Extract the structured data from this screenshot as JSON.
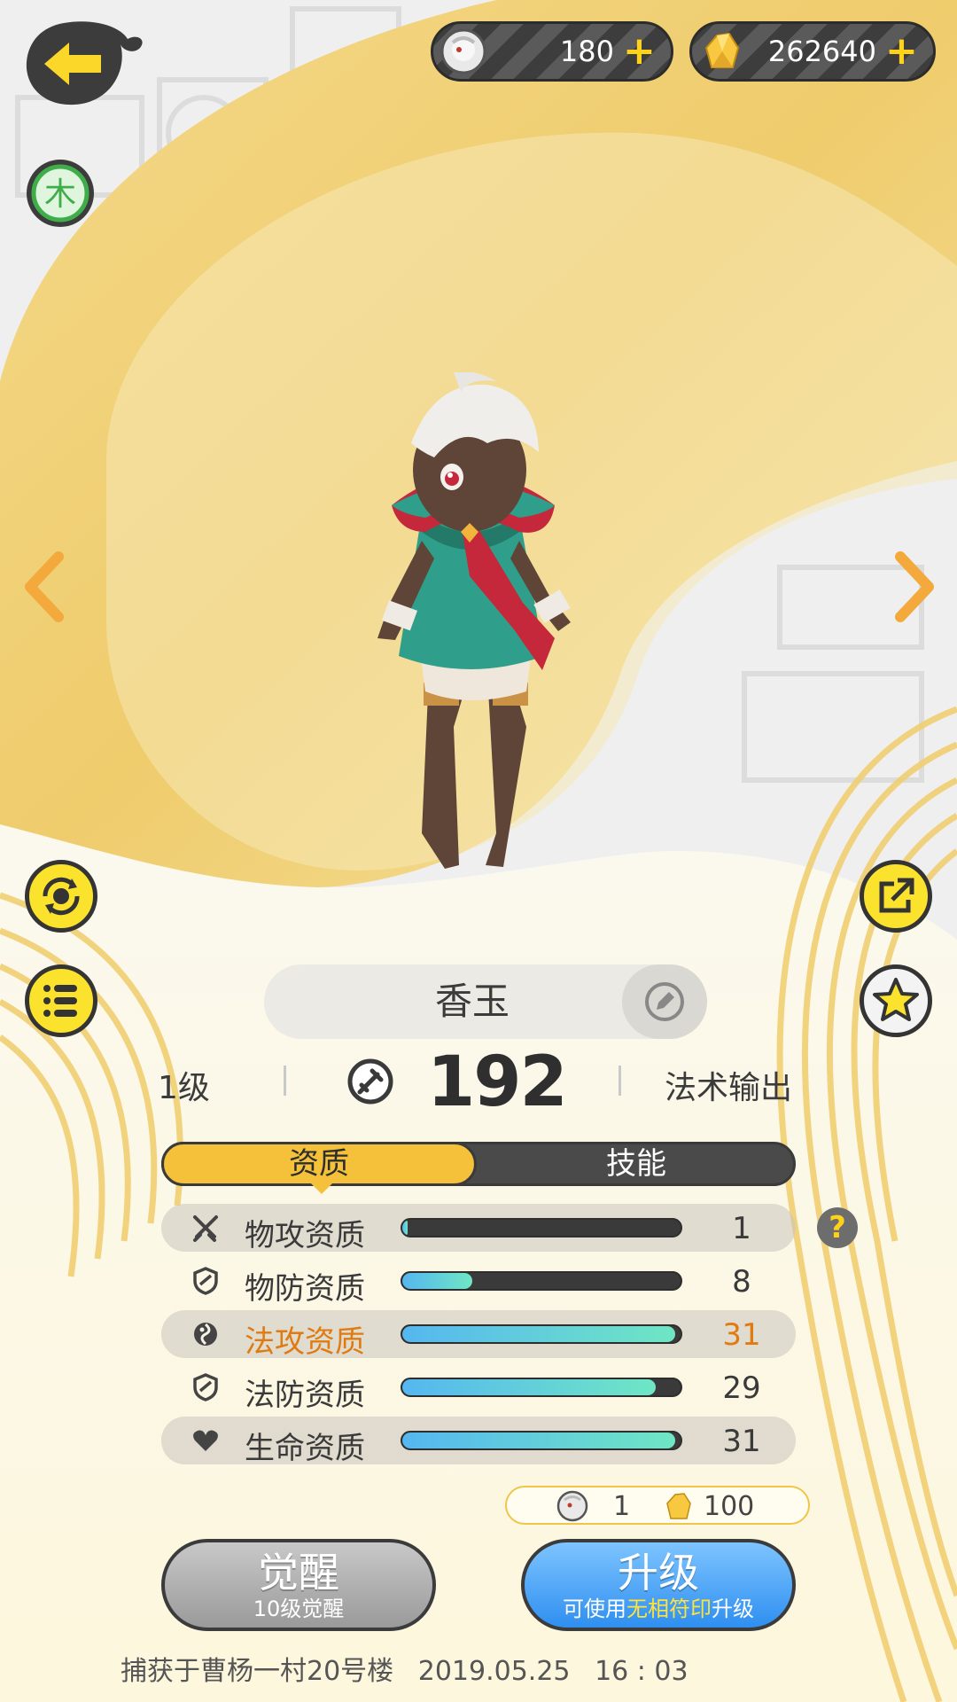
{
  "currency": {
    "soul_value": "180",
    "crystal_value": "262640",
    "plus": "+"
  },
  "element": {
    "label": "木",
    "color": "#3fae4a"
  },
  "pet": {
    "name": "香玉",
    "level": "1级",
    "power": "192",
    "role": "法术输出"
  },
  "tabs": {
    "active": "资质",
    "inactive": "技能"
  },
  "attributes": [
    {
      "label": "物攻资质",
      "value": "1",
      "fill": 0.02,
      "icon": "crossed-swords-icon"
    },
    {
      "label": "物防资质",
      "value": "8",
      "fill": 0.25,
      "icon": "shield-icon"
    },
    {
      "label": "法攻资质",
      "value": "31",
      "fill": 0.98,
      "icon": "orb-icon"
    },
    {
      "label": "法防资质",
      "value": "29",
      "fill": 0.91,
      "icon": "shield-icon"
    },
    {
      "label": "生命资质",
      "value": "31",
      "fill": 0.98,
      "icon": "heart-icon"
    }
  ],
  "help_label": "?",
  "cost": {
    "soul": "1",
    "crystal": "100"
  },
  "awaken": {
    "label": "觉醒",
    "sub": "10级觉醒"
  },
  "upgrade": {
    "label": "升级",
    "sub_pre": "可使用",
    "sub_highlight": "无相符印",
    "sub_post": "升级"
  },
  "footer": {
    "location": "捕获于曹杨一村20号楼",
    "date": "2019.05.25",
    "time": "16 : 03"
  },
  "colors": {
    "accent_yellow": "#f5c13a",
    "highlight_orange": "#e07b12",
    "bar_start": "#55b7f0",
    "bar_end": "#6fe6c4"
  }
}
